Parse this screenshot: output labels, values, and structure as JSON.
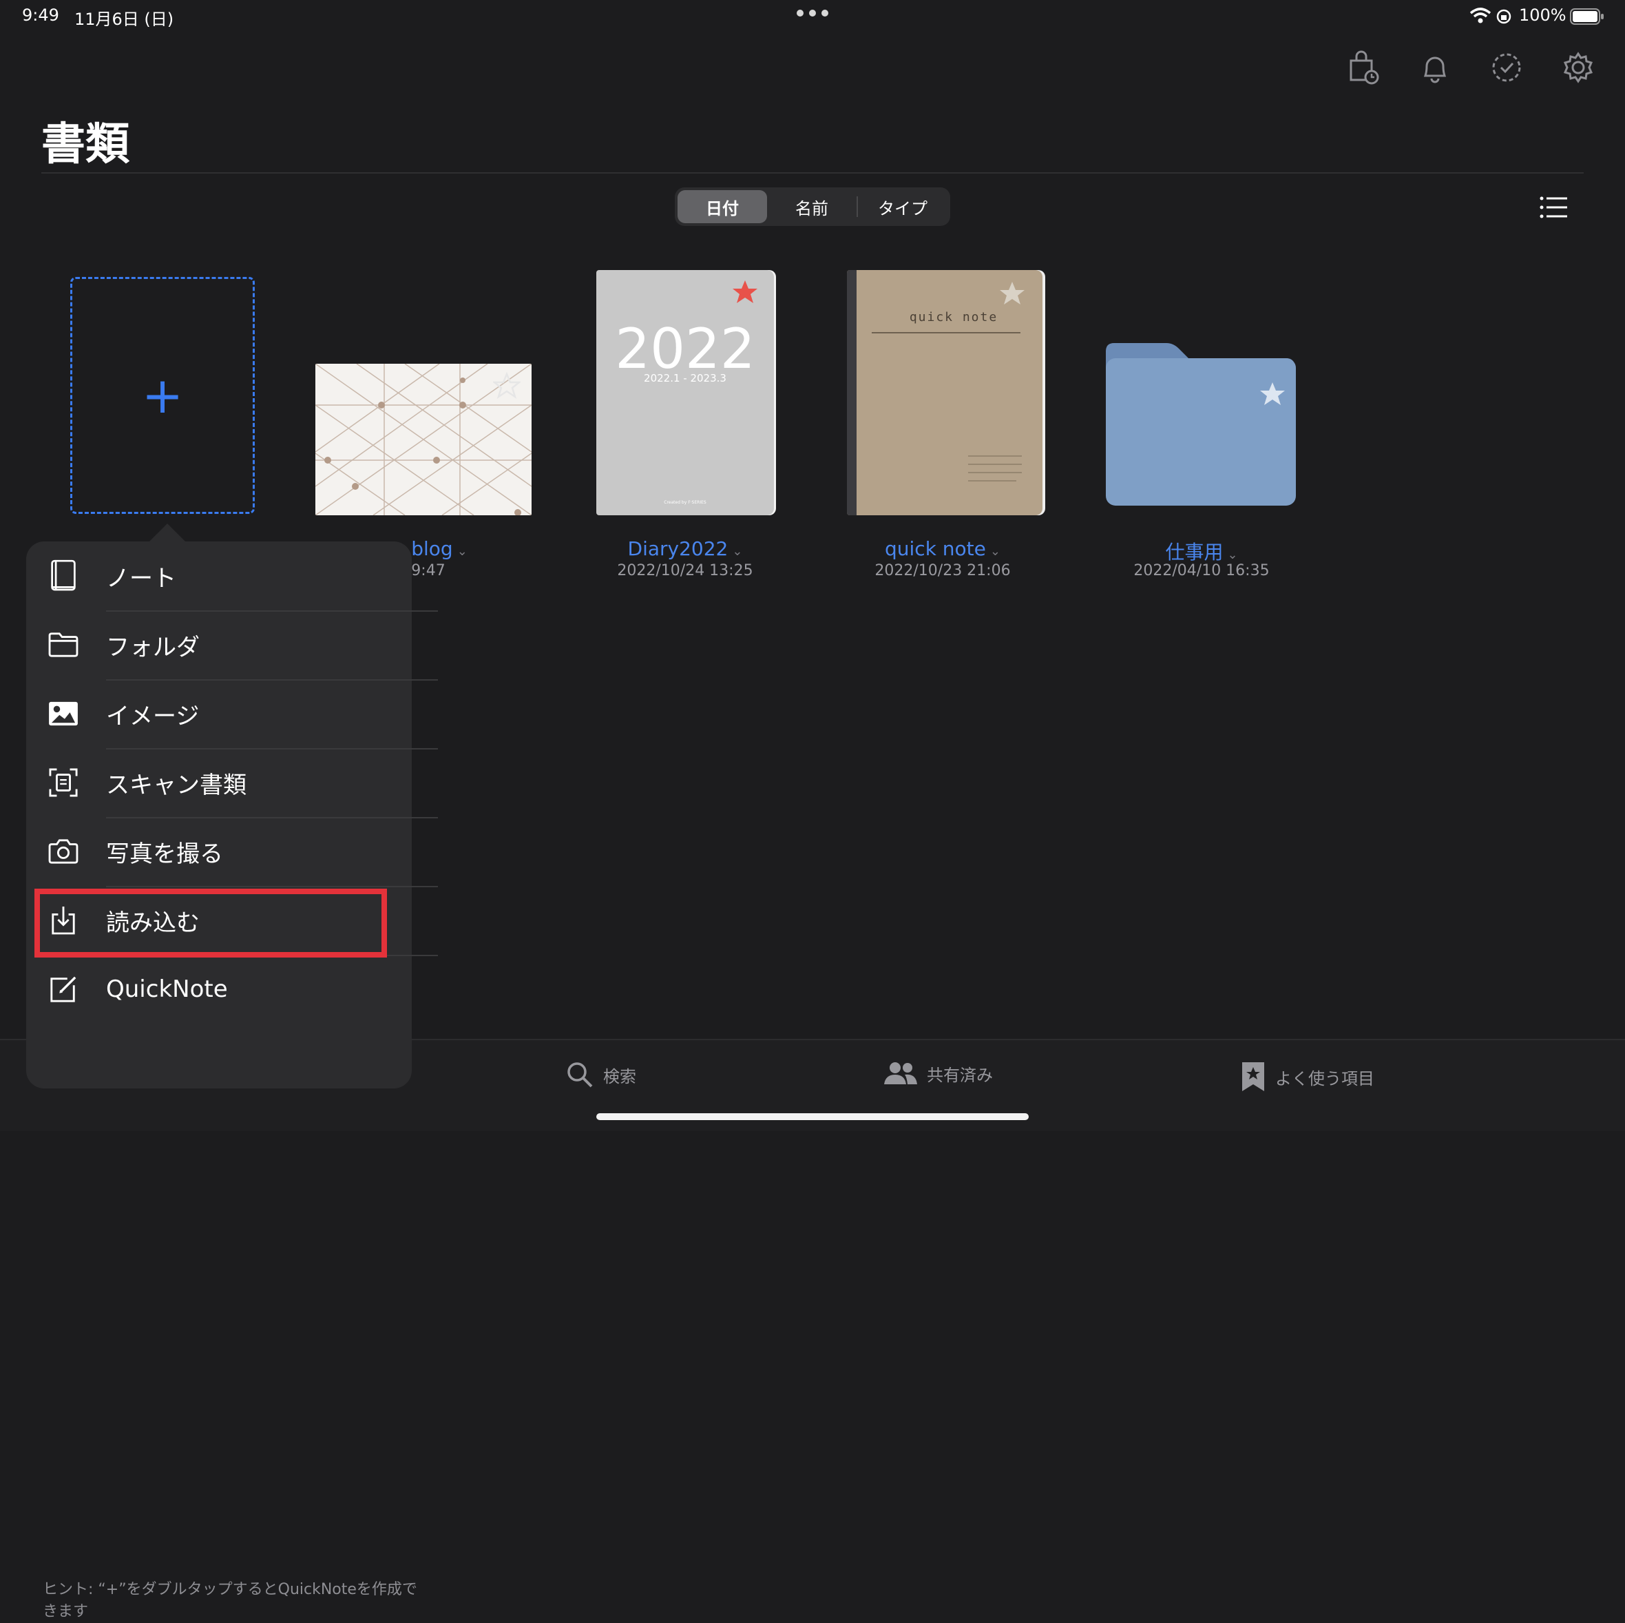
{
  "status": {
    "time": "9:49",
    "date": "11月6日 (日)",
    "battery": "100%"
  },
  "header": {
    "title": "書類"
  },
  "sort": {
    "options": [
      "日付",
      "名前",
      "タイプ"
    ],
    "selected": "日付"
  },
  "documents": [
    {
      "name": "blog",
      "date": "9:47",
      "starred": false
    },
    {
      "name": "Diary2022",
      "date": "2022/10/24 13:25",
      "starred": true,
      "cover_title": "2022",
      "cover_subtitle": "2022.1 - 2023.3",
      "cover_credit": "Created by F·SERIES"
    },
    {
      "name": "quick note",
      "date": "2022/10/23 21:06",
      "starred": false,
      "cover_title": "quick note"
    },
    {
      "name": "仕事用",
      "date": "2022/04/10 16:35",
      "starred": false,
      "type": "folder"
    }
  ],
  "menu": {
    "items": [
      {
        "label": "ノート",
        "icon": "notebook-icon"
      },
      {
        "label": "フォルダ",
        "icon": "folder-icon"
      },
      {
        "label": "イメージ",
        "icon": "image-icon"
      },
      {
        "label": "スキャン書類",
        "icon": "scan-icon"
      },
      {
        "label": "写真を撮る",
        "icon": "camera-icon"
      },
      {
        "label": "読み込む",
        "icon": "import-icon",
        "highlighted": true
      },
      {
        "label": "QuickNote",
        "icon": "quicknote-icon"
      }
    ],
    "hint": "ヒント: “+”をダブルタップするとQuickNoteを作成できます"
  },
  "tabs": [
    {
      "label": "検索",
      "icon": "search-icon"
    },
    {
      "label": "共有済み",
      "icon": "people-icon"
    },
    {
      "label": "よく使う項目",
      "icon": "bookmark-star-icon"
    }
  ],
  "colors": {
    "accent": "#3a7bf0",
    "highlight": "#e4323a",
    "star_active": "#e8524a",
    "folder": "#7f9fc6"
  }
}
